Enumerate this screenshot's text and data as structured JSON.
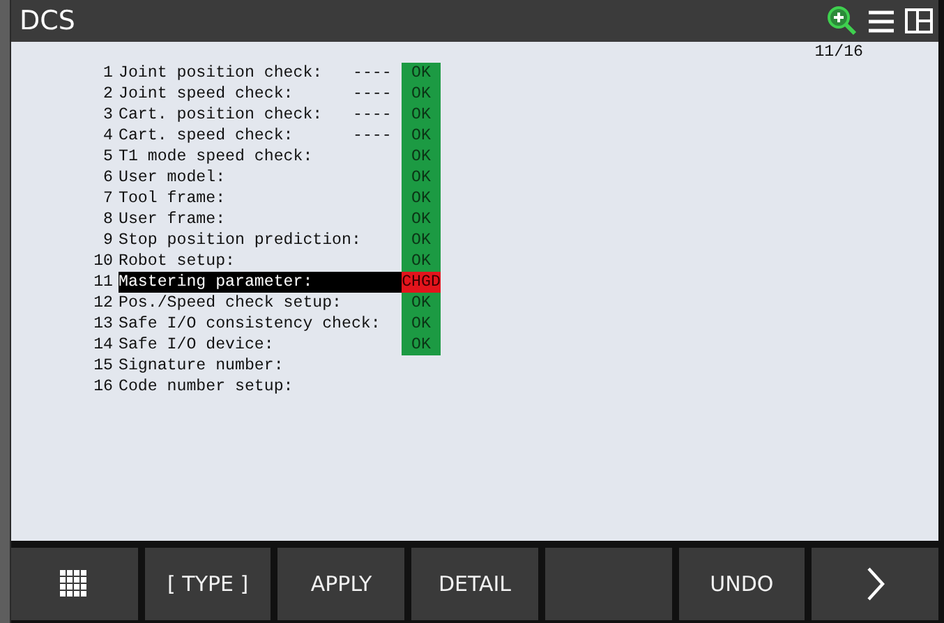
{
  "title": "DCS",
  "page": "11/16",
  "rows": [
    {
      "number": "1",
      "label": "Joint position check:",
      "dashes": "----",
      "status": {
        "text": "OK",
        "kind": "ok"
      },
      "selected": false
    },
    {
      "number": "2",
      "label": "Joint speed check:",
      "dashes": "----",
      "status": {
        "text": "OK",
        "kind": "ok"
      },
      "selected": false
    },
    {
      "number": "3",
      "label": "Cart. position check:",
      "dashes": "----",
      "status": {
        "text": "OK",
        "kind": "ok"
      },
      "selected": false
    },
    {
      "number": "4",
      "label": "Cart. speed check:",
      "dashes": "----",
      "status": {
        "text": "OK",
        "kind": "ok"
      },
      "selected": false
    },
    {
      "number": "5",
      "label": "T1 mode speed check:",
      "status": {
        "text": "OK",
        "kind": "ok"
      },
      "selected": false
    },
    {
      "number": "6",
      "label": "User model:",
      "status": {
        "text": "OK",
        "kind": "ok"
      },
      "selected": false
    },
    {
      "number": "7",
      "label": "Tool frame:",
      "status": {
        "text": "OK",
        "kind": "ok"
      },
      "selected": false
    },
    {
      "number": "8",
      "label": "User frame:",
      "status": {
        "text": "OK",
        "kind": "ok"
      },
      "selected": false
    },
    {
      "number": "9",
      "label": "Stop position prediction:",
      "status": {
        "text": "OK",
        "kind": "ok"
      },
      "selected": false
    },
    {
      "number": "10",
      "label": "Robot setup:",
      "status": {
        "text": "OK",
        "kind": "ok"
      },
      "selected": false
    },
    {
      "number": "11",
      "label": "Mastering parameter:",
      "status": {
        "text": "CHGD",
        "kind": "changed"
      },
      "selected": true
    },
    {
      "number": "12",
      "label": "Pos./Speed check setup:",
      "status": {
        "text": "OK",
        "kind": "ok"
      },
      "selected": false
    },
    {
      "number": "13",
      "label": "Safe I/O consistency check:",
      "status": {
        "text": "OK",
        "kind": "ok"
      },
      "selected": false
    },
    {
      "number": "14",
      "label": "Safe I/O device:",
      "status": {
        "text": "OK",
        "kind": "ok"
      },
      "selected": false
    },
    {
      "number": "15",
      "label": "Signature number:",
      "selected": false
    },
    {
      "number": "16",
      "label": "Code number setup:",
      "selected": false
    }
  ],
  "softkeys": [
    {
      "kind": "menu"
    },
    {
      "kind": "label",
      "label": "[ TYPE ]"
    },
    {
      "kind": "label",
      "label": "APPLY"
    },
    {
      "kind": "label",
      "label": "DETAIL"
    },
    {
      "kind": "blank"
    },
    {
      "kind": "label",
      "label": "UNDO"
    },
    {
      "kind": "next"
    }
  ]
}
